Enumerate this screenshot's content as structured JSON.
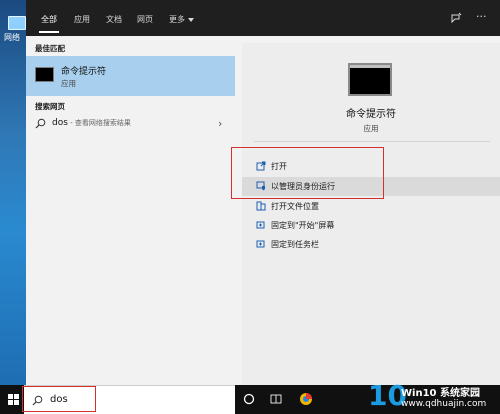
{
  "desktop": {
    "icon_label": "网络"
  },
  "tabs": [
    {
      "label": "全部"
    },
    {
      "label": "应用"
    },
    {
      "label": "文档"
    },
    {
      "label": "网页"
    },
    {
      "label": "更多"
    }
  ],
  "left": {
    "best_match_title": "最佳匹配",
    "best_match_name": "命令提示符",
    "best_match_type": "应用",
    "web_title": "搜索网页",
    "web_query": "dos",
    "web_hint": " - 查看网络搜索结果"
  },
  "right": {
    "app_name": "命令提示符",
    "app_type": "应用",
    "actions": [
      {
        "label": "打开",
        "icon": "open-icon"
      },
      {
        "label": "以管理员身份运行",
        "icon": "shield-icon"
      },
      {
        "label": "打开文件位置",
        "icon": "folder-icon"
      },
      {
        "label": "固定到\"开始\"屏幕",
        "icon": "pin-icon"
      },
      {
        "label": "固定到任务栏",
        "icon": "pin-icon"
      }
    ]
  },
  "taskbar": {
    "search_value": "dos"
  },
  "watermark": {
    "brand": "Win10 系统家园",
    "url": "www.qdhuajin.com",
    "number": "10"
  },
  "colors": {
    "highlight": "#d62f2f",
    "selected": "#a8d0ee",
    "panel_bg": "#f2f2f2",
    "topbar": "#1f1f1f"
  }
}
